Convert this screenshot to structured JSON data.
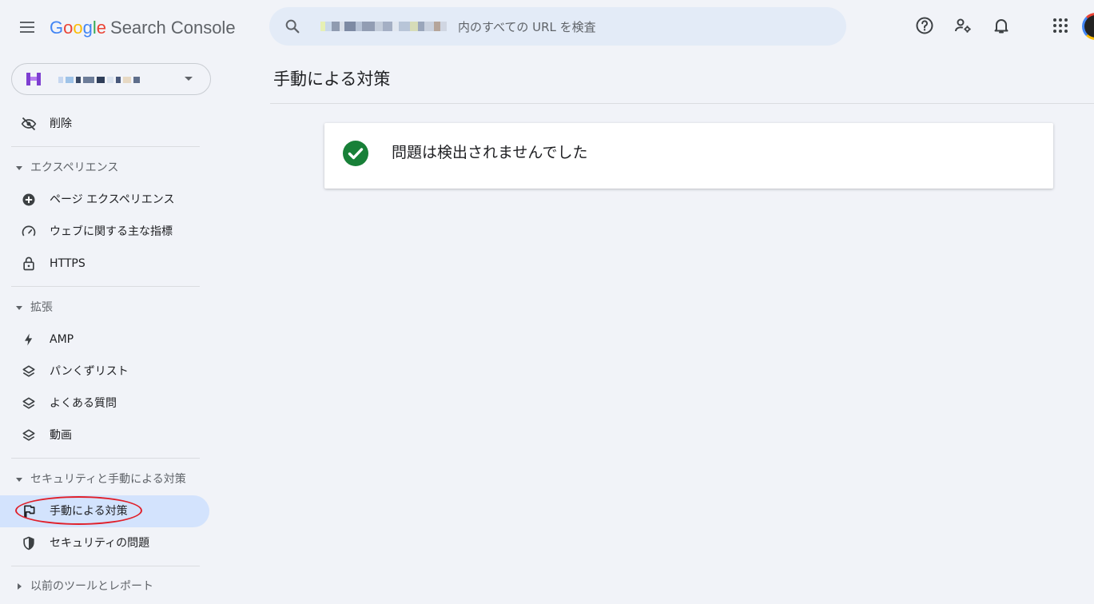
{
  "app": {
    "logo_google": "Google",
    "logo_product": "Search Console"
  },
  "search": {
    "placeholder": "内のすべての URL を検査"
  },
  "header_icons": [
    "help-icon",
    "manage-users-icon",
    "notifications-icon",
    "apps-grid-icon"
  ],
  "sidebar": {
    "items": [
      {
        "label": "削除",
        "icon": "eye-off-icon"
      },
      {
        "label": "ページ エクスペリエンス",
        "icon": "plus-circle-icon"
      },
      {
        "label": "ウェブに関する主な指標",
        "icon": "gauge-icon"
      },
      {
        "label": "HTTPS",
        "icon": "lock-icon"
      },
      {
        "label": "AMP",
        "icon": "bolt-icon"
      },
      {
        "label": "パンくずリスト",
        "icon": "layers-icon"
      },
      {
        "label": "よくある質問",
        "icon": "layers-icon"
      },
      {
        "label": "動画",
        "icon": "layers-icon"
      },
      {
        "label": "手動による対策",
        "icon": "flag-icon",
        "active": true
      },
      {
        "label": "セキュリティの問題",
        "icon": "shield-icon"
      }
    ],
    "sections": [
      {
        "label": "エクスペリエンス",
        "expanded": true
      },
      {
        "label": "拡張",
        "expanded": true
      },
      {
        "label": "セキュリティと手動による対策",
        "expanded": true
      },
      {
        "label": "以前のツールとレポート",
        "expanded": false
      }
    ]
  },
  "main": {
    "title": "手動による対策",
    "status_message": "問題は検出されませんでした",
    "status_icon": "check-circle-icon"
  },
  "colors": {
    "background": "#f1f3f8",
    "search_bg": "#e3ebf7",
    "active_item": "#d3e3fd",
    "check_green": "#188038",
    "annotation_red": "#e0202a"
  }
}
